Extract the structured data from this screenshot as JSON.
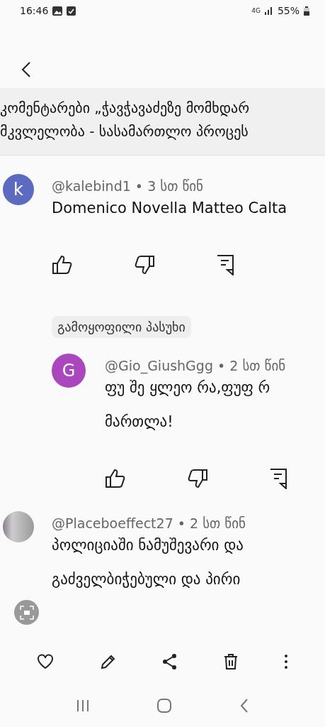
{
  "status_bar": {
    "time": "16:46",
    "network": "4G",
    "battery": "55%"
  },
  "banner": {
    "lines": [
      "კომენტარები „ჭავჭავაძეზე მომხდარ",
      "მკვლელობა - სასამართლო პროცეს"
    ]
  },
  "comments": [
    {
      "kind": "letter",
      "avatar": "k",
      "color": "#5c6bc0",
      "author": "@kalebind1",
      "separator": "•",
      "time": "3 სთ წინ",
      "lines": [
        "Domenico Novella Matteo Calta"
      ],
      "reply": false
    },
    {
      "kind": "letter",
      "avatar": "G",
      "color": "#ab47bc",
      "author": "@Gio_GiushGgg",
      "separator": "•",
      "time": "2 სთ წინ",
      "badge": "გამოყოფილი პასუხი",
      "lines": [
        "ფუ შე ყლეო რა,ფუფ რ",
        "მართლა!"
      ],
      "reply": true
    },
    {
      "kind": "photo",
      "author": "@Placeboeffect27",
      "separator": "•",
      "time": "2 სთ წინ",
      "lines": [
        "პოლიციაში ნამუშევარი და",
        "გაძველბიჭებული და პირი"
      ],
      "reply": false
    }
  ]
}
